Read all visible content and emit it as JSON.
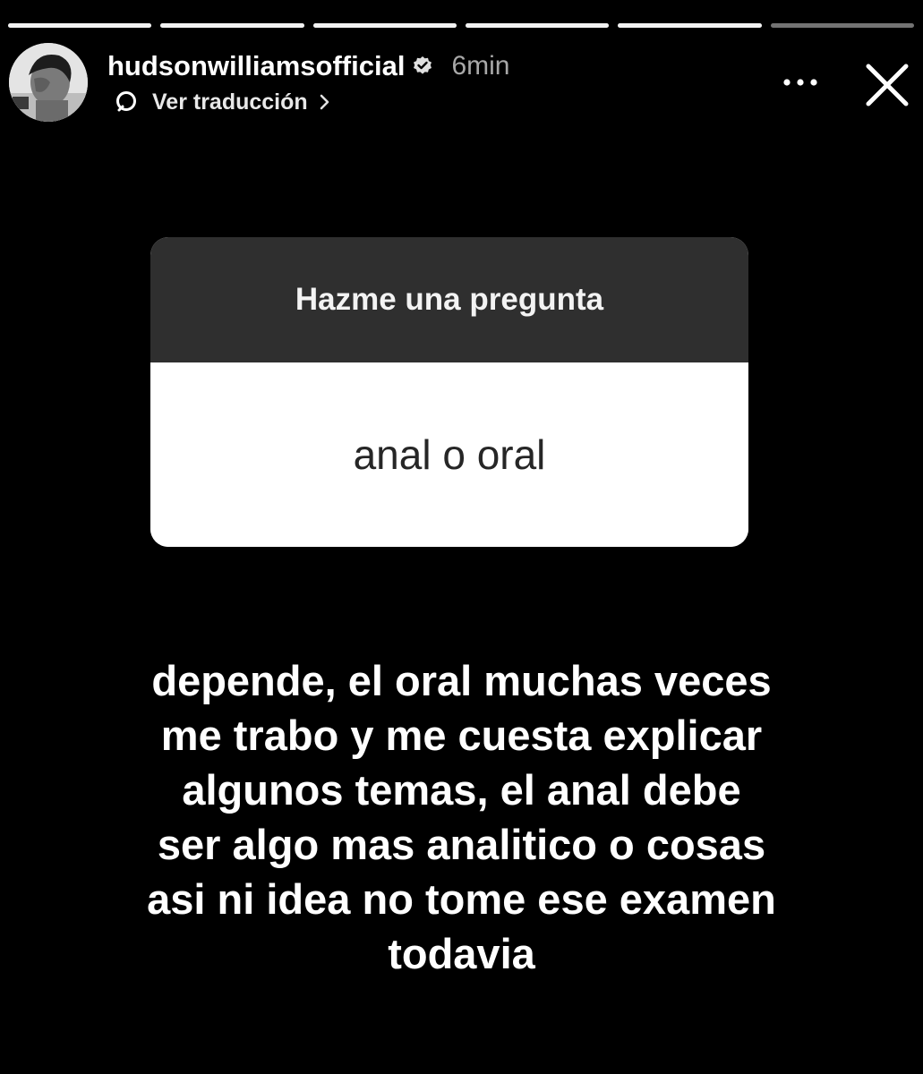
{
  "story": {
    "progress": {
      "segments": 6,
      "completed": 5,
      "current_fraction": 0.0
    },
    "header": {
      "username": "hudsonwilliamsofficial",
      "verified": true,
      "time_ago": "6min",
      "translate_label": "Ver traducción",
      "icons": {
        "avatar": "profile-avatar",
        "verified": "verified-badge-icon",
        "translate": "speech-bubble-icon",
        "chevron": "chevron-right-icon",
        "more": "more-options-icon",
        "close": "close-icon"
      }
    },
    "question_sticker": {
      "prompt": "Hazme una pregunta",
      "question": "anal o oral"
    },
    "answer": {
      "lines": [
        "depende, el oral muchas veces",
        "me trabo y me cuesta explicar",
        "algunos temas, el anal debe",
        "ser algo mas analitico o cosas",
        "asi ni idea no tome ese examen",
        "todavia"
      ]
    }
  },
  "colors": {
    "background": "#000000",
    "card_header": "#2f2f2f",
    "card_body": "#ffffff",
    "secondary_text": "#a8a8a8"
  }
}
